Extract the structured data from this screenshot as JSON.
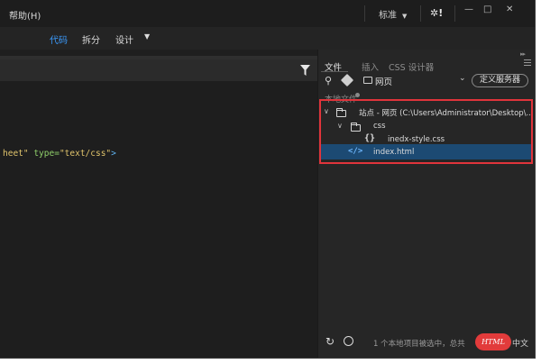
{
  "menubar": {
    "help": "帮助(H)",
    "workspace": "标准",
    "sync_icon": "sync-gear-icon",
    "window_controls": [
      "—",
      "□",
      "✕"
    ]
  },
  "view_tabs": [
    {
      "label": "代码",
      "active": true
    },
    {
      "label": "拆分",
      "active": false
    },
    {
      "label": "设计",
      "active": false
    }
  ],
  "editor": {
    "code_parts": [
      {
        "text": "heet\"",
        "type": "string"
      },
      {
        "text": " type=",
        "type": "attr"
      },
      {
        "text": "\"text/css\"",
        "type": "string"
      },
      {
        "text": ">",
        "type": "tag"
      }
    ],
    "filter_icon": "filter-icon"
  },
  "panel": {
    "tabs": [
      {
        "label": "文件",
        "active": true
      },
      {
        "label": "插入",
        "active": false
      },
      {
        "label": "CSS 设计器",
        "active": false
      }
    ],
    "site_select": "网页",
    "define_server": "定义服务器",
    "local_files": "本地文件",
    "tree": [
      {
        "label": "站点 - 网页 (C:\\Users\\Administrator\\Desktop\\...",
        "icon": "folder-icon",
        "level": 0
      },
      {
        "label": "css",
        "icon": "folder-icon",
        "level": 1
      },
      {
        "label": "inedx-style.css",
        "icon": "css-braces-icon",
        "level": 2
      },
      {
        "label": "index.html",
        "icon": "html-code-icon",
        "level": 1,
        "selected": true
      }
    ],
    "status": "1 个本地项目被选中，总共"
  },
  "watermark": {
    "text": "HTML",
    "suffix": "中文"
  },
  "colors": {
    "accent": "#3b9cff",
    "selection": "#1c4a73",
    "highlight_box": "#e0343b"
  }
}
